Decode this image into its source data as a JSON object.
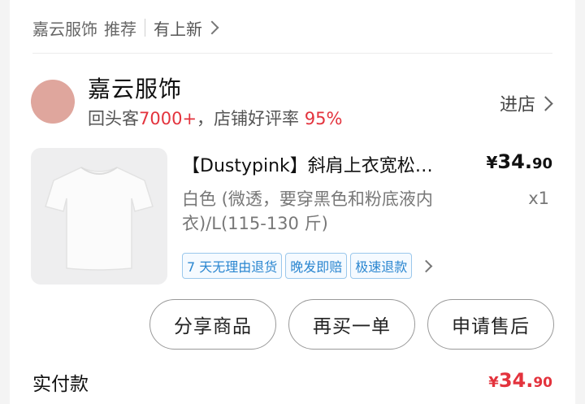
{
  "breadcrumb": {
    "shop": "嘉云服饰",
    "recommend": "推荐",
    "new_arrivals": "有上新"
  },
  "shop": {
    "name": "嘉云服饰",
    "stats_prefix": "回头客",
    "returning": "7000+",
    "stats_mid": "，店铺好评率",
    "rating": "95%",
    "enter_label": "进店",
    "avatar_color": "#dfa69d"
  },
  "product": {
    "title": "【Dustypink】斜肩上衣宽松…",
    "price_currency": "¥",
    "price_int": "34.",
    "price_dec": "90",
    "spec": "白色 (微透，要穿黑色和粉底液内衣)/L(115-130 斤)",
    "quantity": "x1",
    "tags": [
      "7 天无理由退货",
      "晚发即赔",
      "极速退款"
    ]
  },
  "actions": {
    "share": "分享商品",
    "rebuy": "再买一单",
    "after_sale": "申请售后"
  },
  "payment": {
    "label": "实付款",
    "currency": "¥",
    "int": "34.",
    "dec": "90"
  },
  "colors": {
    "accent_red": "#e3333d",
    "tag_blue": "#2a86d0"
  }
}
